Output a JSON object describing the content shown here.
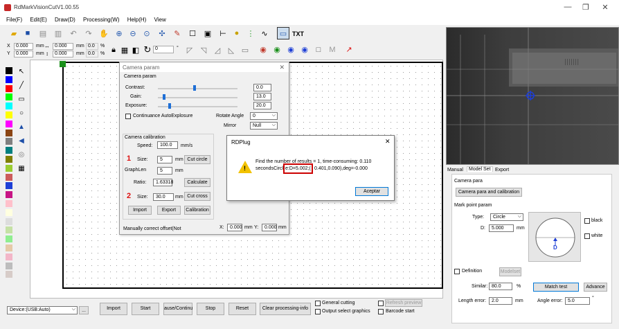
{
  "window": {
    "title": "RdMarkVisionCutV1.00.55",
    "min": "—",
    "max": "❐",
    "close": "✕"
  },
  "menu": [
    "File(F)",
    "Edit(E)",
    "Draw(D)",
    "Processing(W)",
    "Help(H)",
    "View"
  ],
  "toolbar": {
    "txt": "TXT",
    "rotate_value": "0",
    "degree": "°"
  },
  "coords": {
    "x_label": "X",
    "y_label": "Y",
    "x": "0.000",
    "y": "0.000",
    "unit": "mm",
    "w": "0.000",
    "h": "0.000",
    "pct1": "0.0",
    "pct2": "0.0",
    "pct_unit": "%"
  },
  "palette": [
    "#000000",
    "#0000ff",
    "#ff0000",
    "#00ff00",
    "#00ffff",
    "#ffff00",
    "#8b4513",
    "#808080",
    "#008000",
    "#9acd32",
    "#cd5c5c",
    "#1e90ff",
    "#ff00ff",
    "#800000",
    "#ffc0cb",
    "#c0c0c0",
    "#ffffe0",
    "#90ee90",
    "#ffb6c1",
    "#add8e6",
    "#dda0dd",
    "#7fffd4",
    "#98fb98",
    "#bc8f8f"
  ],
  "camera_dialog": {
    "title": "Camera param",
    "group1": "Camera param",
    "contrast_label": "Contrast:",
    "contrast": "0.0",
    "gain_label": "Gain:",
    "gain": "13.0",
    "exposure_label": "Exposure:",
    "exposure": "20.0",
    "auto_exposure": "Continuance AutoExplosure",
    "rotate_label": "Rotate Angle",
    "rotate_value": "0",
    "mirror_label": "Mirror",
    "mirror_value": "Null",
    "calib_group": "Camera calibration",
    "speed_label": "Speed:",
    "speed": "100.0",
    "speed_unit": "mm/s",
    "marker1": "1",
    "size_label": "Size:",
    "size1": "5",
    "mm": "mm",
    "cut_circle": "Cut circle",
    "graphlen_label": "GraphLen",
    "graphlen": "5",
    "ratio_label": "Ratio:",
    "ratio": "1.63318",
    "calculate": "Calculate",
    "marker2": "2",
    "size2": "30.0",
    "cut_cross": "Cut cross",
    "import": "Import",
    "export": "Export",
    "calibration": "Calibration",
    "manual_offset": "Manually correct offset(Not",
    "x_label": "X:",
    "x_val": "0.000",
    "y_label": "Y:",
    "y_val": "0.000",
    "close": "✕"
  },
  "rdplug": {
    "title": "RDPlug",
    "line1": "Find the number of results = 1, time-consuming: 0.110",
    "line2_a": "secondsCircl",
    "line2_hl": "e:D=5.002;(",
    "line2_b": "0.401,0.090),deg=-0.000",
    "ok": "Aceptar",
    "warn_icon": "!",
    "close": "✕"
  },
  "camera_view": {
    "crosshair_color": "#1e3fd6"
  },
  "right_panel": {
    "tabs": [
      "Manual",
      "Model Set",
      "Export"
    ],
    "camera_para_group": "Camera para",
    "camera_para_btn": "Camera para and calibration",
    "mark_group": "Mark point param",
    "type_label": "Type:",
    "type_value": "Circle",
    "d_label": "D:",
    "d_value": "5.000",
    "mm": "mm",
    "black": "black",
    "white": "white",
    "preview_letter": "D",
    "definition": "Definition",
    "modelset": "Modelset",
    "similar_label": "Similar:",
    "similar": "80.0",
    "pct": "%",
    "match_test": "Match test",
    "advance": "Advance",
    "length_err_label": "Length error:",
    "length_err": "2.0",
    "angle_err_label": "Angle error:",
    "angle_err": "5.0",
    "deg": "°"
  },
  "bottom": {
    "device": "Device:(USB:Auto)",
    "more": "...",
    "import": "Import",
    "start": "Start",
    "pause": "ause/Continu",
    "stop": "Stop",
    "reset": "Reset",
    "clear": "Clear processing-info",
    "general_cutting": "General cutting",
    "output_select": "Output select graphics",
    "refresh_preview": "Refresh preview",
    "barcode_start": "Barcode start"
  }
}
